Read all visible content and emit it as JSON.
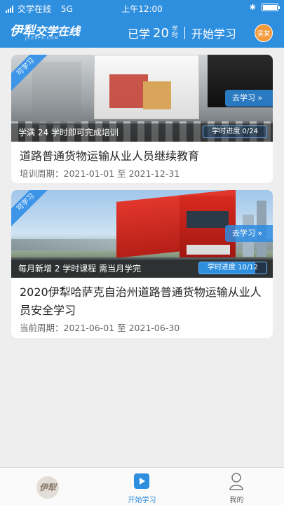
{
  "status_bar": {
    "carrier": "交学在线",
    "network": "5G",
    "time": "上午12:00"
  },
  "header": {
    "logo_text_1": "伊犁",
    "logo_text_2": "交学在线",
    "logo_sub": "JXZXPX.COM",
    "studied_label": "已学",
    "studied_hours": "20",
    "unit": "学时",
    "start_label": "开始学习",
    "user_name": "吴某"
  },
  "courses": [
    {
      "badge": "可学习",
      "go_label": "去学习 »",
      "info": "学满 24 学时即可完成培训",
      "progress_label": "学时进度 0/24",
      "progress": 0.0,
      "title": "道路普通货物运输从业人员继续教育",
      "period": "培训周期：2021-01-01 至 2021-12-31"
    },
    {
      "badge": "可学习",
      "go_label": "去学习 »",
      "info": "每月新增 2 学时课程    需当月学完",
      "progress_label": "学时进度 10/12",
      "progress": 0.833,
      "title": "2020伊犁哈萨克自治州道路普通货物运输从业人员安全学习",
      "period": "当前周期：2021-06-01 至 2021-06-30"
    }
  ],
  "bottom_nav": {
    "home_logo": "伊犁",
    "start_label": "开始学习",
    "mine_label": "我的"
  },
  "colors": {
    "primary": "#2f8fdf",
    "accent_orange": "#f39a3b"
  }
}
